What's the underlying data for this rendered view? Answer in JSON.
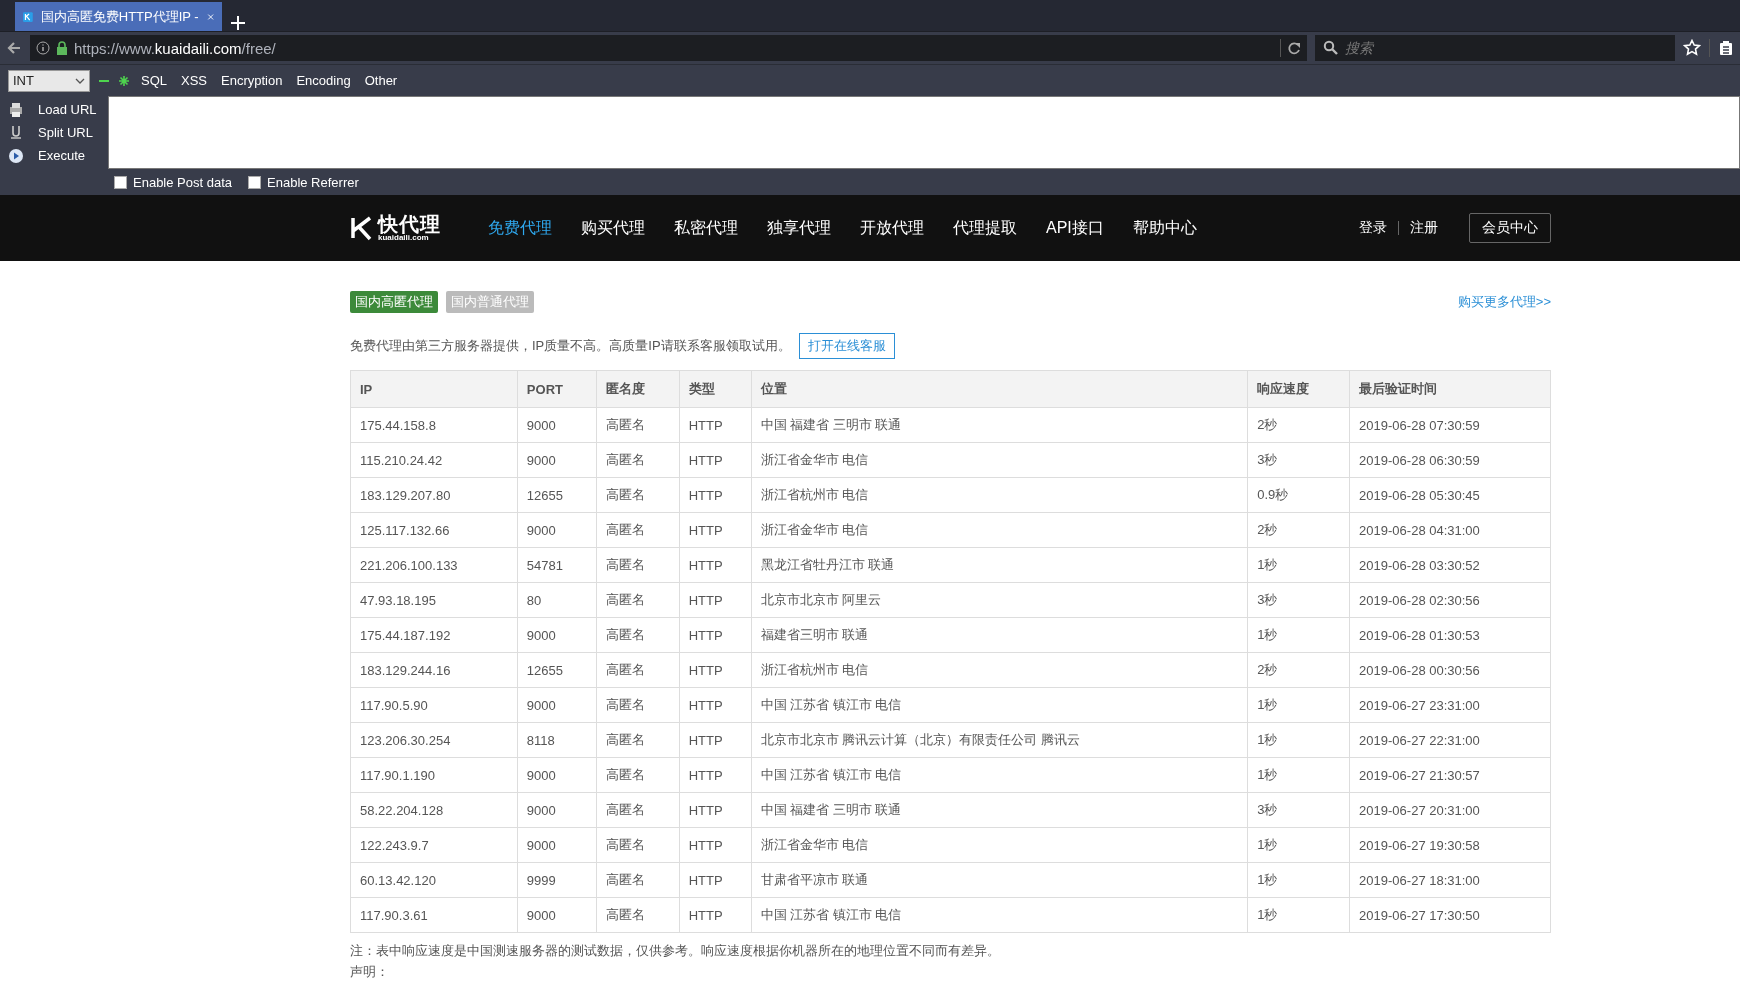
{
  "browser": {
    "tab_title": "国内高匿免费HTTP代理IP -",
    "url_parts": [
      {
        "text": "https://www.",
        "kind": "dim"
      },
      {
        "text": "kuaidaili.com",
        "kind": "bright"
      },
      {
        "text": "/free/",
        "kind": "dim"
      }
    ],
    "search_placeholder": "搜索"
  },
  "hackbar": {
    "select_value": "INT",
    "menus": [
      "SQL",
      "XSS",
      "Encryption",
      "Encoding",
      "Other"
    ],
    "actions": [
      {
        "label": "Load URL",
        "kind": "load"
      },
      {
        "label": "Split URL",
        "kind": "split"
      },
      {
        "label": "Execute",
        "kind": "execute"
      }
    ],
    "checkboxes": [
      {
        "label": "Enable Post data",
        "checked": false
      },
      {
        "label": "Enable Referrer",
        "checked": false
      }
    ]
  },
  "site_nav": {
    "logo_text": "快代理",
    "logo_sub": "kuaidaili.com",
    "items": [
      {
        "label": "免费代理",
        "selected": true
      },
      {
        "label": "购买代理",
        "selected": false
      },
      {
        "label": "私密代理",
        "selected": false
      },
      {
        "label": "独享代理",
        "selected": false
      },
      {
        "label": "开放代理",
        "selected": false
      },
      {
        "label": "代理提取",
        "selected": false
      },
      {
        "label": "API接口",
        "selected": false
      },
      {
        "label": "帮助中心",
        "selected": false
      }
    ],
    "login": "登录",
    "register": "注册",
    "member": "会员中心"
  },
  "page": {
    "tabs": [
      {
        "label": "国内高匿代理",
        "selected": true
      },
      {
        "label": "国内普通代理",
        "selected": false
      }
    ],
    "buy_more_link": "购买更多代理>>",
    "notice": "免费代理由第三方服务器提供，IP质量不高。高质量IP请联系客服领取试用。",
    "service_button": "打开在线客服"
  },
  "table": {
    "columns": [
      "IP",
      "PORT",
      "匿名度",
      "类型",
      "位置",
      "响应速度",
      "最后验证时间"
    ],
    "rows": [
      [
        "175.44.158.8",
        "9000",
        "高匿名",
        "HTTP",
        "中国 福建省 三明市 联通",
        "2秒",
        "2019-06-28 07:30:59"
      ],
      [
        "115.210.24.42",
        "9000",
        "高匿名",
        "HTTP",
        "浙江省金华市 电信",
        "3秒",
        "2019-06-28 06:30:59"
      ],
      [
        "183.129.207.80",
        "12655",
        "高匿名",
        "HTTP",
        "浙江省杭州市 电信",
        "0.9秒",
        "2019-06-28 05:30:45"
      ],
      [
        "125.117.132.66",
        "9000",
        "高匿名",
        "HTTP",
        "浙江省金华市 电信",
        "2秒",
        "2019-06-28 04:31:00"
      ],
      [
        "221.206.100.133",
        "54781",
        "高匿名",
        "HTTP",
        "黑龙江省牡丹江市 联通",
        "1秒",
        "2019-06-28 03:30:52"
      ],
      [
        "47.93.18.195",
        "80",
        "高匿名",
        "HTTP",
        "北京市北京市 阿里云",
        "3秒",
        "2019-06-28 02:30:56"
      ],
      [
        "175.44.187.192",
        "9000",
        "高匿名",
        "HTTP",
        "福建省三明市 联通",
        "1秒",
        "2019-06-28 01:30:53"
      ],
      [
        "183.129.244.16",
        "12655",
        "高匿名",
        "HTTP",
        "浙江省杭州市 电信",
        "2秒",
        "2019-06-28 00:30:56"
      ],
      [
        "117.90.5.90",
        "9000",
        "高匿名",
        "HTTP",
        "中国 江苏省 镇江市 电信",
        "1秒",
        "2019-06-27 23:31:00"
      ],
      [
        "123.206.30.254",
        "8118",
        "高匿名",
        "HTTP",
        "北京市北京市 腾讯云计算（北京）有限责任公司 腾讯云",
        "1秒",
        "2019-06-27 22:31:00"
      ],
      [
        "117.90.1.190",
        "9000",
        "高匿名",
        "HTTP",
        "中国 江苏省 镇江市 电信",
        "1秒",
        "2019-06-27 21:30:57"
      ],
      [
        "58.22.204.128",
        "9000",
        "高匿名",
        "HTTP",
        "中国 福建省 三明市 联通",
        "3秒",
        "2019-06-27 20:31:00"
      ],
      [
        "122.243.9.7",
        "9000",
        "高匿名",
        "HTTP",
        "浙江省金华市 电信",
        "1秒",
        "2019-06-27 19:30:58"
      ],
      [
        "60.13.42.120",
        "9999",
        "高匿名",
        "HTTP",
        "甘肃省平凉市 联通",
        "1秒",
        "2019-06-27 18:31:00"
      ],
      [
        "117.90.3.61",
        "9000",
        "高匿名",
        "HTTP",
        "中国 江苏省 镇江市 电信",
        "1秒",
        "2019-06-27 17:30:50"
      ]
    ]
  },
  "footnote": "注：表中响应速度是中国测速服务器的测试数据，仅供参考。响应速度根据你机器所在的地理位置不同而有差异。",
  "statement": "声明："
}
